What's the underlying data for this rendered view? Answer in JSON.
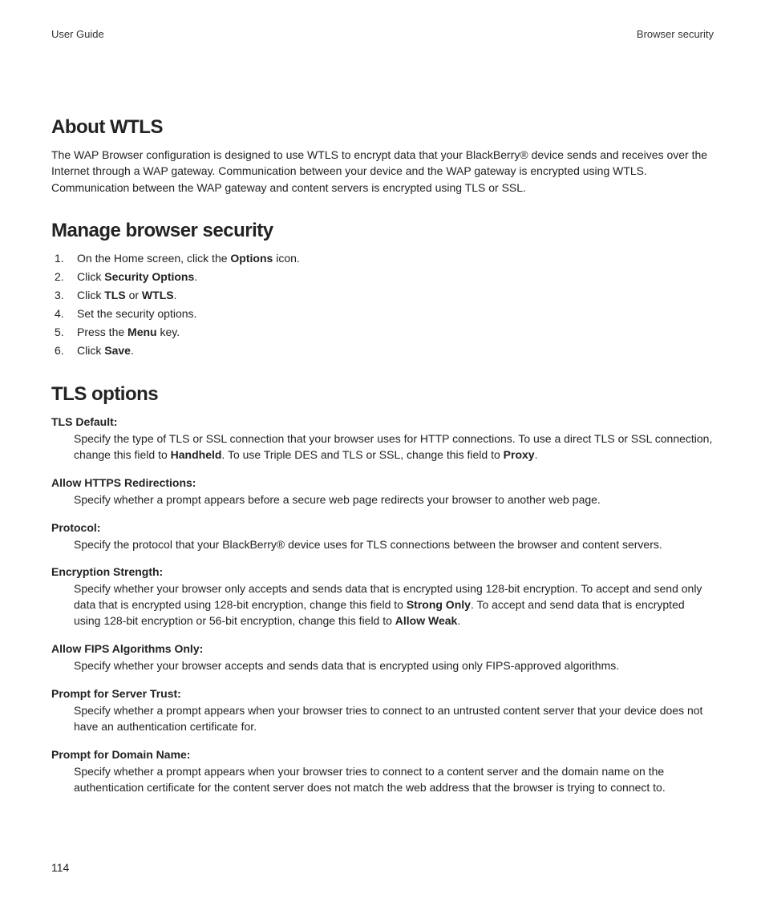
{
  "header": {
    "left": "User Guide",
    "right": "Browser security"
  },
  "pageNumber": "114",
  "sections": {
    "about": {
      "title": "About WTLS",
      "body": "The WAP Browser configuration is designed to use WTLS to encrypt data that your BlackBerry® device sends and receives over the Internet through a WAP gateway. Communication between your device and the WAP gateway is encrypted using WTLS. Communication between the WAP gateway and content servers is encrypted using TLS or SSL."
    },
    "manage": {
      "title": "Manage browser security",
      "steps": [
        {
          "pre": "On the Home screen, click the ",
          "bold": "Options",
          "post": " icon."
        },
        {
          "pre": "Click ",
          "bold": "Security Options",
          "post": "."
        },
        {
          "pre": "Click ",
          "bold": "TLS",
          "mid": " or ",
          "bold2": "WTLS",
          "post": "."
        },
        {
          "pre": "Set the security options."
        },
        {
          "pre": "Press the ",
          "bold": "Menu",
          "post": " key."
        },
        {
          "pre": "Click ",
          "bold": "Save",
          "post": "."
        }
      ]
    },
    "tls": {
      "title": "TLS options",
      "items": [
        {
          "term": "TLS Default:",
          "parts": [
            {
              "t": "Specify the type of TLS or SSL connection that your browser uses for HTTP connections. To use a direct TLS or SSL connection, change this field to "
            },
            {
              "b": "Handheld"
            },
            {
              "t": ". To use Triple DES and TLS or SSL, change this field to "
            },
            {
              "b": "Proxy"
            },
            {
              "t": "."
            }
          ]
        },
        {
          "term": "Allow HTTPS Redirections:",
          "parts": [
            {
              "t": "Specify whether a prompt appears before a secure web page redirects your browser to another web page."
            }
          ]
        },
        {
          "term": "Protocol:",
          "parts": [
            {
              "t": "Specify the protocol that your BlackBerry® device uses for TLS connections between the browser and content servers."
            }
          ]
        },
        {
          "term": "Encryption Strength:",
          "parts": [
            {
              "t": "Specify whether your browser only accepts and sends data that is encrypted using 128-bit encryption. To accept and send only data that is encrypted using 128-bit encryption, change this field to "
            },
            {
              "b": "Strong Only"
            },
            {
              "t": ". To accept and send data that is encrypted using 128-bit encryption or 56-bit encryption, change this field to "
            },
            {
              "b": "Allow Weak"
            },
            {
              "t": "."
            }
          ]
        },
        {
          "term": "Allow FIPS Algorithms Only:",
          "parts": [
            {
              "t": "Specify whether your browser accepts and sends data that is encrypted using only FIPS-approved algorithms."
            }
          ]
        },
        {
          "term": "Prompt for Server Trust:",
          "parts": [
            {
              "t": "Specify whether a prompt appears when your browser tries to connect to an untrusted content server that your device does not have an authentication certificate for."
            }
          ]
        },
        {
          "term": "Prompt for Domain Name:",
          "parts": [
            {
              "t": "Specify whether a prompt appears when your browser tries to connect to a content server and the domain name on the authentication certificate for the content server does not match the web address that the browser is trying to connect to."
            }
          ]
        }
      ]
    }
  }
}
